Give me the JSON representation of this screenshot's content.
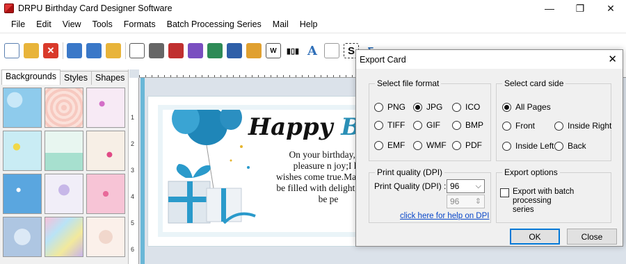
{
  "window": {
    "title": "DRPU Birthday Card Designer Software",
    "controls": [
      "—",
      "❐",
      "✕"
    ]
  },
  "menu": [
    "File",
    "Edit",
    "View",
    "Tools",
    "Formats",
    "Batch Processing Series",
    "Mail",
    "Help"
  ],
  "left_panel": {
    "tabs": [
      "Backgrounds",
      "Styles",
      "Shapes"
    ],
    "active_tab": "Backgrounds"
  },
  "card": {
    "title_a": "Happy ",
    "title_b": "Bi",
    "lines": [
      "On your birthday,I w",
      "pleasure n joy;I ho",
      "wishes come true.May each",
      "be filled with delight, and y",
      "be pe"
    ]
  },
  "ruler_numbers": [
    "1",
    "2",
    "3",
    "4",
    "5",
    "6"
  ],
  "dialog": {
    "title": "Export Card",
    "file_format": {
      "label": "Select file format",
      "options": [
        "PNG",
        "JPG",
        "ICO",
        "TIFF",
        "GIF",
        "BMP",
        "EMF",
        "WMF",
        "PDF"
      ],
      "selected": "JPG"
    },
    "card_side": {
      "label": "Select card side",
      "options": [
        "All Pages",
        "Front",
        "Inside Right",
        "Inside Left",
        "Back"
      ],
      "selected": "All Pages"
    },
    "print_quality": {
      "group_label": "Print quality (DPI)",
      "field_label": "Print Quality (DPI) :",
      "value": "96",
      "value_disabled": "96",
      "help_link": "click here for help on DPI"
    },
    "export_options": {
      "label": "Export options",
      "checkbox_label_1": "Export with batch processing",
      "checkbox_label_2": "series",
      "checked": false
    },
    "ok_label": "OK",
    "close_label": "Close"
  }
}
